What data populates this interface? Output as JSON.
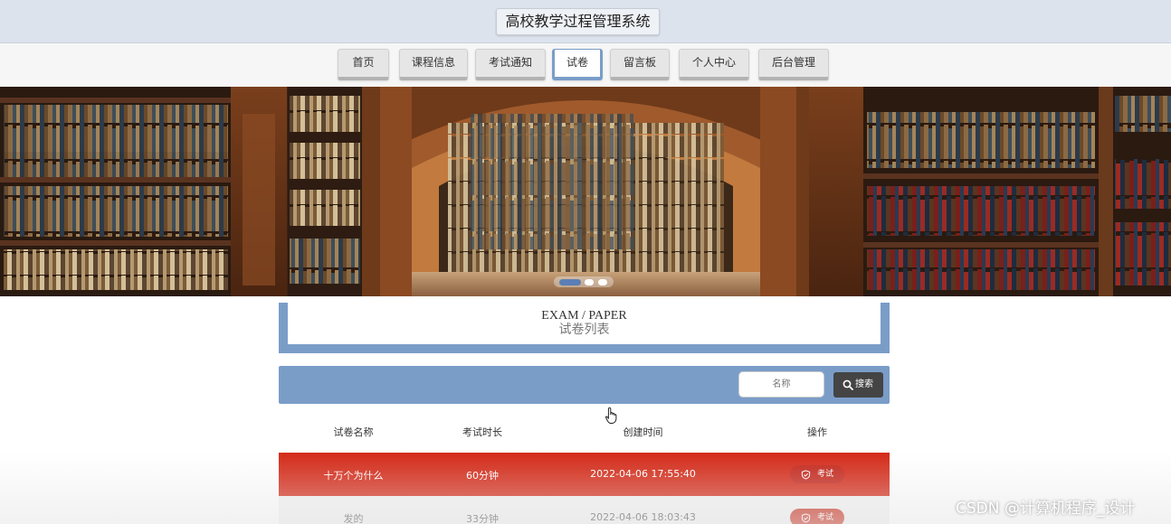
{
  "header": {
    "title": "高校教学过程管理系统"
  },
  "nav": {
    "items": [
      {
        "label": "首页",
        "active": false
      },
      {
        "label": "课程信息",
        "active": false
      },
      {
        "label": "考试通知",
        "active": false
      },
      {
        "label": "试卷",
        "active": true
      },
      {
        "label": "留言板",
        "active": false
      },
      {
        "label": "个人中心",
        "active": false
      },
      {
        "label": "后台管理",
        "active": false
      }
    ]
  },
  "section": {
    "title_en": "EXAM / PAPER",
    "title_zh": "试卷列表"
  },
  "search": {
    "placeholder": "名称",
    "button_label": "搜索"
  },
  "table": {
    "headers": [
      "试卷名称",
      "考试时长",
      "创建时间",
      "操作"
    ],
    "rows": [
      {
        "name": "十万个为什么",
        "duration": "60分钟",
        "created": "2022-04-06 17:55:40",
        "action": "考试"
      },
      {
        "name": "发的",
        "duration": "33分钟",
        "created": "2022-04-06 18:03:43",
        "action": "考试"
      }
    ]
  },
  "carousel": {
    "active_index": 0,
    "count": 3
  },
  "colors": {
    "accent": "#7a9dc8",
    "highlight_row": "#d42a18",
    "search_button": "#444444"
  },
  "watermark": "CSDN @计算机程序_设计"
}
